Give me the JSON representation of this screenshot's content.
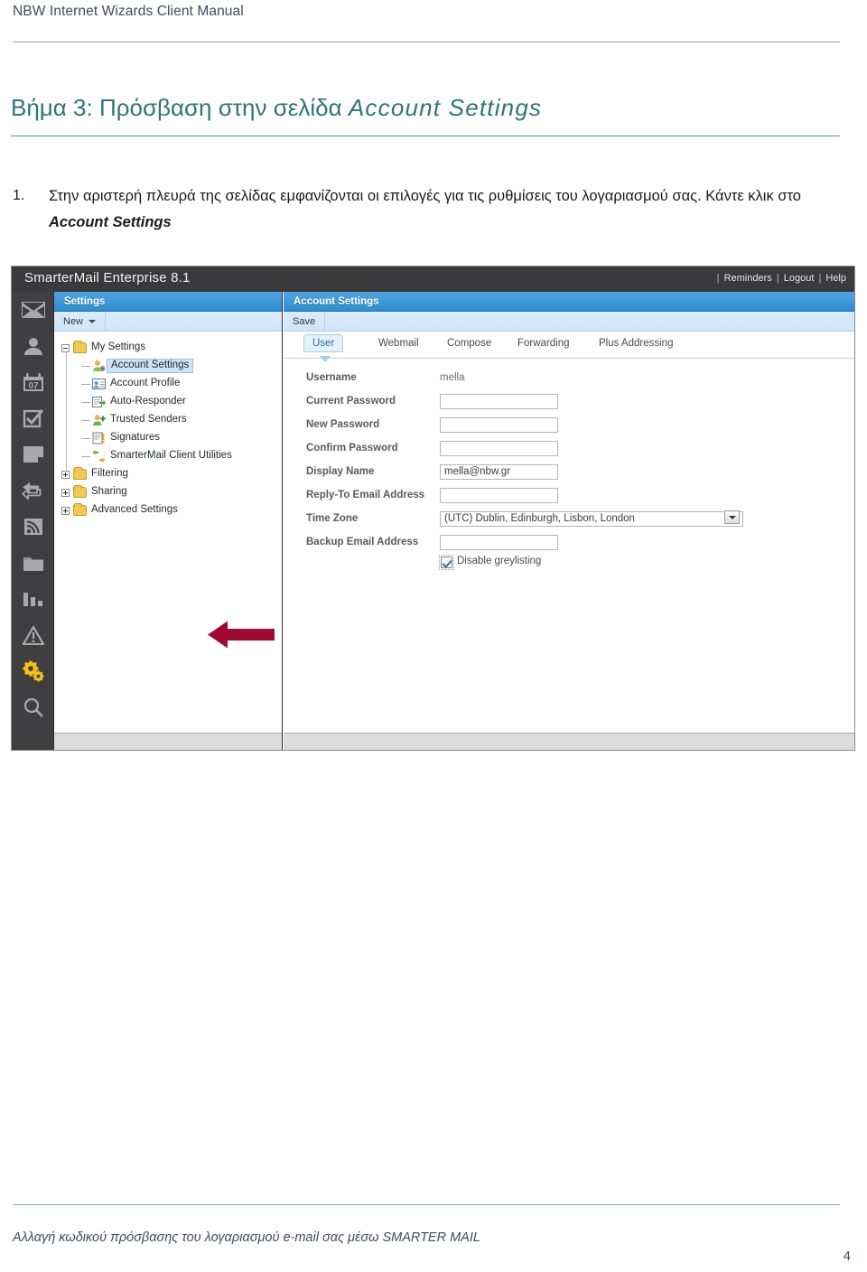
{
  "document": {
    "header_title": "NBW Internet Wizards Client Manual",
    "section_heading_normal": "Βήμα 3: Πρόσβαση στην σελίδα ",
    "section_heading_italic": "Account Settings",
    "list_number": "1.",
    "paragraph_part1": "Στην αριστερή πλευρά της σελίδας εμφανίζονται οι επιλογές για τις ρυθμίσεις του λογαριασμού σας. Κάντε κλικ στο ",
    "paragraph_bold": "Account Settings",
    "footer_text": "Αλλαγή κωδικού πρόσβασης του λογαριασμού e-mail σας μέσω SMARTER MAIL",
    "page_number": "4",
    "heading_color": "#2f7479",
    "header_color": "#3f4a63",
    "annotation_arrow_color": "#9e0b32"
  },
  "screenshot": {
    "titlebar": {
      "brand": "SmarterMail Enterprise 8.1",
      "links": [
        "Reminders",
        "Logout",
        "Help"
      ],
      "separator": "|",
      "background": "#3a3a3c"
    },
    "rail": {
      "items": [
        {
          "name": "email-icon",
          "label": "Email"
        },
        {
          "name": "contacts-icon",
          "label": "Contacts"
        },
        {
          "name": "calendar-icon",
          "label": "Calendar",
          "day": "07"
        },
        {
          "name": "tasks-icon",
          "label": "Tasks"
        },
        {
          "name": "notes-icon",
          "label": "Notes"
        },
        {
          "name": "reply-forward-icon",
          "label": "Chat"
        },
        {
          "name": "rss-feeds-icon",
          "label": "RSS Feeds"
        },
        {
          "name": "file-storage-icon",
          "label": "File Storage"
        },
        {
          "name": "reports-icon",
          "label": "Reports"
        },
        {
          "name": "alerts-icon",
          "label": "Alerts"
        },
        {
          "name": "settings-gear-icon",
          "label": "Settings",
          "active": true
        },
        {
          "name": "search-icon",
          "label": "Search"
        }
      ],
      "active_color": "#f2c018"
    },
    "left_panel": {
      "header": "Settings",
      "toolbar_button": "New",
      "tree": [
        {
          "label": "My Settings",
          "type": "folder",
          "expander": "minus",
          "level": 0
        },
        {
          "label": "Account Settings",
          "type": "leaf",
          "icon": "account-settings-icon",
          "level": 1,
          "selected": true
        },
        {
          "label": "Account Profile",
          "type": "leaf",
          "icon": "account-profile-icon",
          "level": 1
        },
        {
          "label": "Auto-Responder",
          "type": "leaf",
          "icon": "auto-responder-icon",
          "level": 1
        },
        {
          "label": "Trusted Senders",
          "type": "leaf",
          "icon": "trusted-senders-icon",
          "level": 1
        },
        {
          "label": "Signatures",
          "type": "leaf",
          "icon": "signatures-icon",
          "level": 1
        },
        {
          "label": "SmarterMail Client Utilities",
          "type": "leaf",
          "icon": "client-utilities-icon",
          "level": 1
        },
        {
          "label": "Filtering",
          "type": "folder",
          "expander": "plus",
          "level": 0
        },
        {
          "label": "Sharing",
          "type": "folder",
          "expander": "plus",
          "level": 0
        },
        {
          "label": "Advanced Settings",
          "type": "folder",
          "expander": "plus",
          "level": 0
        }
      ]
    },
    "right_panel": {
      "header": "Account Settings",
      "toolbar_button": "Save",
      "tabs": [
        {
          "label": "User",
          "active": true
        },
        {
          "label": "Webmail",
          "active": false
        },
        {
          "label": "Compose",
          "active": false
        },
        {
          "label": "Forwarding",
          "active": false
        },
        {
          "label": "Plus Addressing",
          "active": false
        }
      ],
      "fields": [
        {
          "label": "Username",
          "kind": "static",
          "value": "mella"
        },
        {
          "label": "Current Password",
          "kind": "input",
          "value": ""
        },
        {
          "label": "New Password",
          "kind": "input",
          "value": ""
        },
        {
          "label": "Confirm Password",
          "kind": "input",
          "value": ""
        },
        {
          "label": "Display Name",
          "kind": "input",
          "value": "mella@nbw.gr"
        },
        {
          "label": "Reply-To Email Address",
          "kind": "input",
          "value": ""
        },
        {
          "label": "Time Zone",
          "kind": "select",
          "value": "(UTC) Dublin, Edinburgh, Lisbon, London"
        },
        {
          "label": "Backup Email Address",
          "kind": "input",
          "value": ""
        }
      ],
      "checkbox": {
        "label": "Disable greylisting",
        "checked": true
      }
    }
  }
}
